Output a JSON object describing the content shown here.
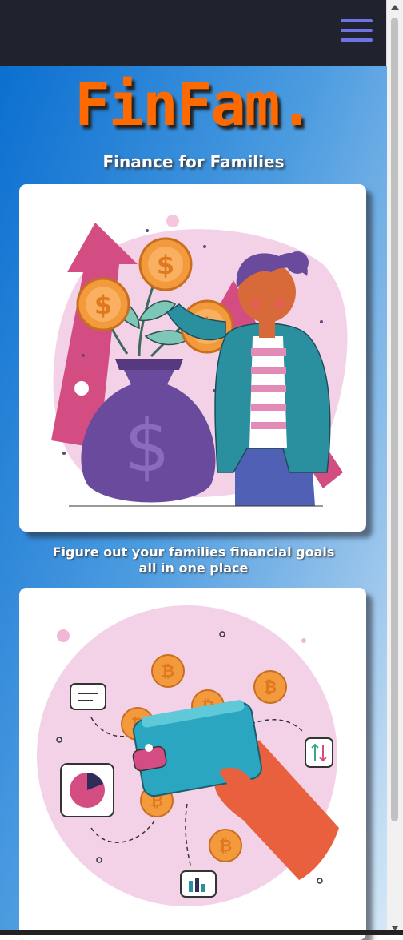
{
  "nav": {
    "menu_icon": "hamburger-menu-icon"
  },
  "hero": {
    "brand": "FinFam.",
    "tagline": "Finance for Families",
    "subtitle_line1": "Figure out your families financial goals",
    "subtitle_line2": "all in one place"
  },
  "illustrations": [
    {
      "icon": "money-bag-growth-illustration"
    },
    {
      "icon": "wallet-bitcoin-illustration"
    }
  ],
  "colors": {
    "navbar": "#20222e",
    "menu_icon": "#6e73e6",
    "brand": "#ff6a00",
    "coin": "#f7943a",
    "bag": "#6a4a9c",
    "jacket": "#2a8f9e",
    "pink_blob": "#f3d2e8"
  }
}
